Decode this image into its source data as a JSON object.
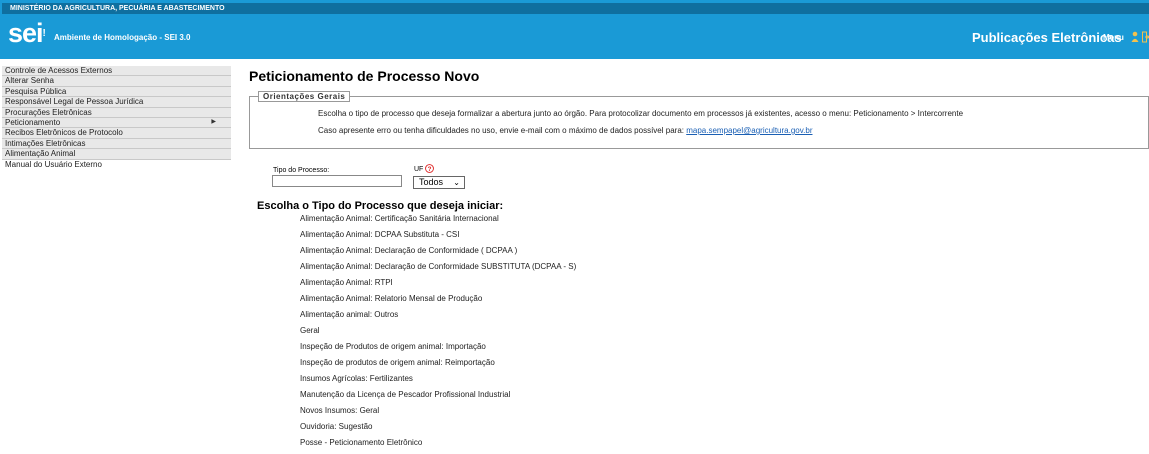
{
  "header": {
    "ministry": "MINISTÉRIO DA AGRICULTURA, PECUÁRIA E ABASTECIMENTO",
    "logo": "sei",
    "logo_dot": "!",
    "environment": "Ambiente de Homologação - SEI 3.0",
    "title": "Publicações Eletrônicas",
    "menu_label": "Menu",
    "bg_color": "#1a9ad6"
  },
  "sidebar": {
    "items": [
      {
        "label": "Controle de Acessos Externos"
      },
      {
        "label": "Alterar Senha"
      },
      {
        "label": "Pesquisa Pública"
      },
      {
        "label": "Responsável Legal de Pessoa Jurídica"
      },
      {
        "label": "Procurações Eletrônicas"
      },
      {
        "label": "Peticionamento",
        "arrow": "▶"
      },
      {
        "label": "Recibos Eletrônicos de Protocolo"
      },
      {
        "label": "Intimações Eletrônicas"
      },
      {
        "label": "Alimentação Animal"
      },
      {
        "label": "Manual do Usuário Externo"
      }
    ]
  },
  "main": {
    "title": "Peticionamento de Processo Novo",
    "orientacoes": {
      "legend": "Orientações Gerais",
      "line1": "Escolha o tipo de processo que deseja formalizar a abertura junto ao órgão. Para protocolizar documento em processos já existentes, acesso o menu: Peticionamento > Intercorrente",
      "line2_prefix": "Caso apresente erro ou tenha dificuldades no uso, envie e-mail com o máximo de dados possível para: ",
      "email": "mapa.sempapel@agricultura.gov.br"
    },
    "tipo_label": "Tipo do Processo:",
    "tipo_value": "",
    "uf_label": "UF",
    "uf_selected": "Todos",
    "choose_title": "Escolha o Tipo do Processo que deseja iniciar:",
    "processes": [
      "Alimentação Animal: Certificação Sanitária Internacional",
      "Alimentação Animal: DCPAA Substituta - CSI",
      "Alimentação Animal: Declaração de Conformidade ( DCPAA )",
      "Alimentação Animal: Declaração de Conformidade SUBSTITUTA (DCPAA - S)",
      "Alimentação Animal: RTPI",
      "Alimentação Animal: Relatorio Mensal de Produção",
      "Alimentação animal: Outros",
      "Geral",
      "Inspeção de Produtos de origem animal: Importação",
      "Inspeção de produtos de origem animal: Reimportação",
      "Insumos Agrícolas: Fertilizantes",
      "Manutenção da Licença de Pescador Profissional Industrial",
      "Novos Insumos: Geral",
      "Ouvidoria: Sugestão",
      "Posse - Peticionamento Eletrônico"
    ]
  }
}
